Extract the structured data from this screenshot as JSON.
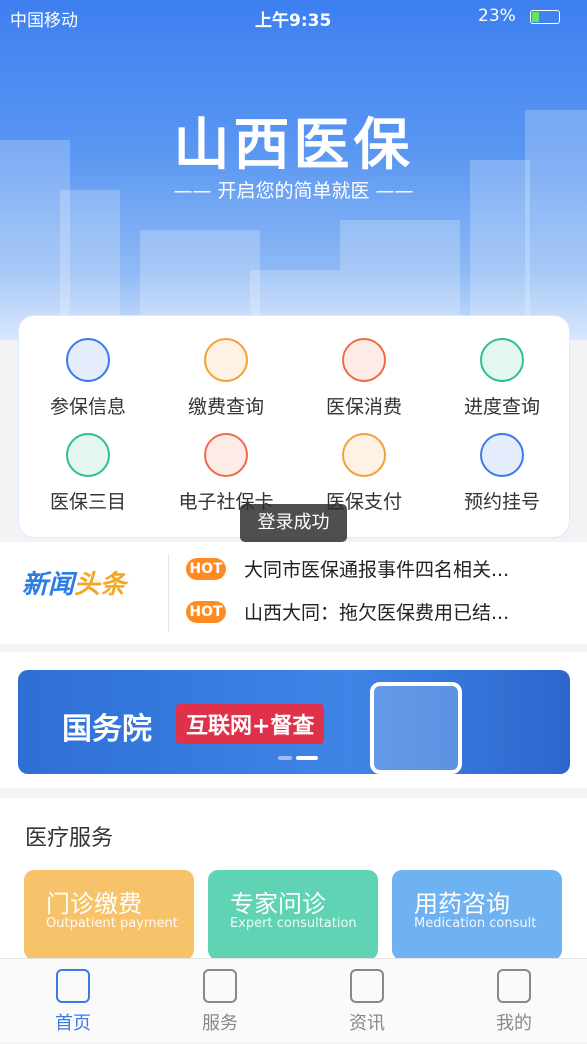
{
  "status_bar": {
    "carrier": "中国移动",
    "time": "上午9:35",
    "battery": "23%"
  },
  "hero": {
    "title": "山西医保",
    "subtitle": "—— 开启您的简单就医 ——"
  },
  "grid": [
    {
      "label": "参保信息",
      "icon": "insurance-info-icon",
      "color": "#3b7be8"
    },
    {
      "label": "缴费查询",
      "icon": "payment-query-icon",
      "color": "#f2a137"
    },
    {
      "label": "医保消费",
      "icon": "yuan-icon",
      "color": "#ef6b4a"
    },
    {
      "label": "进度查询",
      "icon": "progress-icon",
      "color": "#2fbf8f"
    },
    {
      "label": "医保三目",
      "icon": "list-icon",
      "color": "#2fbf8f"
    },
    {
      "label": "电子社保卡",
      "icon": "si-card-icon",
      "color": "#ef6b4a"
    },
    {
      "label": "医保支付",
      "icon": "wallet-icon",
      "color": "#f2a137"
    },
    {
      "label": "预约挂号",
      "icon": "plus-icon",
      "color": "#3b7be8"
    }
  ],
  "toast": "登录成功",
  "news": {
    "logo_a": "新闻",
    "logo_b": "头条",
    "hot": "HOT",
    "items": [
      "大同市医保通报事件四名相关...",
      "山西大同：拖欠医保费用已结..."
    ]
  },
  "banner": {
    "title": "国务院",
    "tag": "互联网+督查"
  },
  "services": {
    "title": "医疗服务",
    "cards": [
      {
        "title": "门诊缴费",
        "sub": "Outpatient payment",
        "color": "#f7c36a"
      },
      {
        "title": "专家问诊",
        "sub": "Expert consultation",
        "color": "#5fd3b4"
      },
      {
        "title": "用药咨询",
        "sub": "Medication consult",
        "color": "#6fb2f2"
      }
    ]
  },
  "tabs": [
    {
      "label": "首页",
      "icon": "home-icon",
      "active": true
    },
    {
      "label": "服务",
      "icon": "services-icon",
      "active": false
    },
    {
      "label": "资讯",
      "icon": "news-icon",
      "active": false
    },
    {
      "label": "我的",
      "icon": "profile-icon",
      "active": false
    }
  ]
}
